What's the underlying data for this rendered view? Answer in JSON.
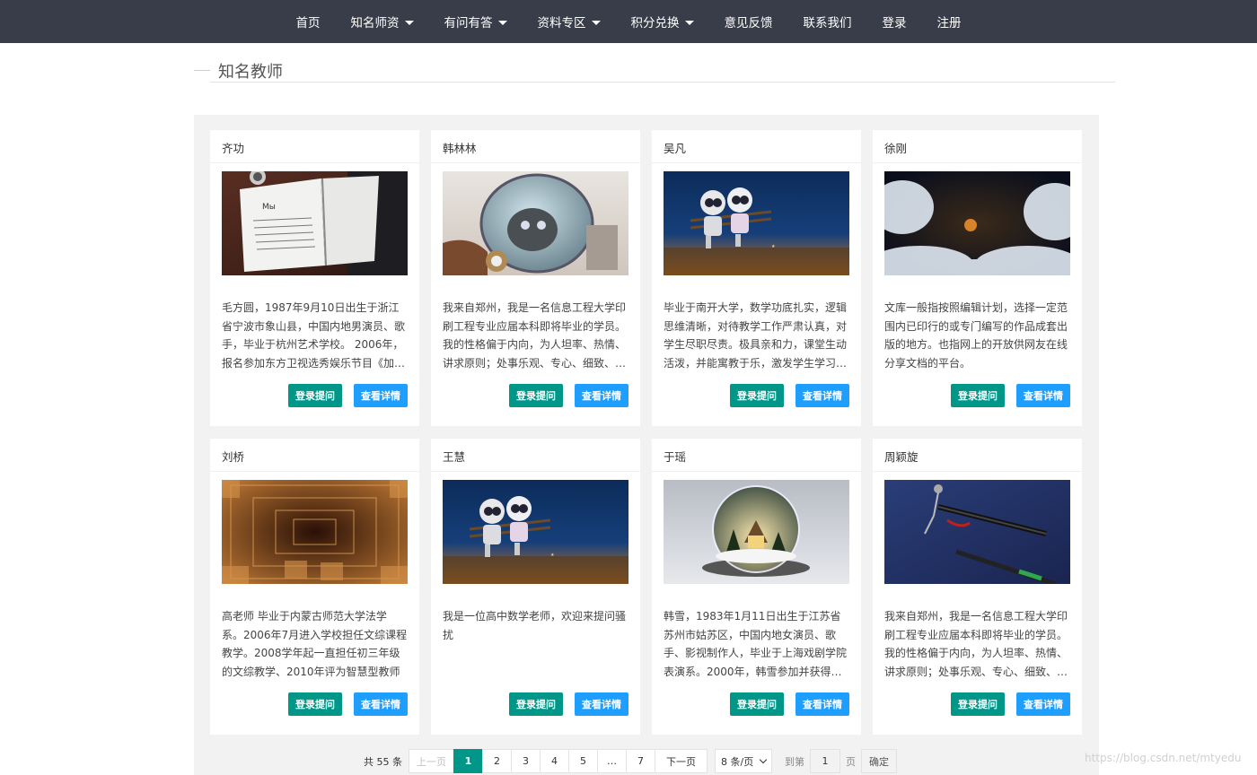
{
  "nav": {
    "items": [
      {
        "label": "首页",
        "dropdown": false
      },
      {
        "label": "知名师资",
        "dropdown": true
      },
      {
        "label": "有问有答",
        "dropdown": true
      },
      {
        "label": "资料专区",
        "dropdown": true
      },
      {
        "label": "积分兑换",
        "dropdown": true
      },
      {
        "label": "意见反馈",
        "dropdown": false
      },
      {
        "label": "联系我们",
        "dropdown": false
      },
      {
        "label": "登录",
        "dropdown": false
      },
      {
        "label": "注册",
        "dropdown": false
      }
    ]
  },
  "section": {
    "title": "知名教师"
  },
  "buttons": {
    "ask": "登录提问",
    "detail": "查看详情"
  },
  "teachers": [
    {
      "name": "齐功",
      "image": "notebook-photo",
      "desc": "毛方圆，1987年9月10日出生于浙江省宁波市象山县，中国内地男演员、歌手，毕业于杭州艺术学校。 2006年，报名参加东方卫视选秀娱乐节目《加油！好男儿》"
    },
    {
      "name": "韩林林",
      "image": "astronaut-photo",
      "desc": "我来自郑州，我是一名信息工程大学印刷工程专业应届本科即将毕业的学员。 我的性格偏于内向，为人坦率、热情、讲求原则；处事乐观、专心、细致、头脑清醒"
    },
    {
      "name": "吴凡",
      "image": "robots-bench-photo",
      "desc": "毕业于南开大学，数学功底扎实，逻辑思维清晰，对待教学工作严肃认真，对学生尽职尽责。极具亲和力，课堂生动活泼，并能寓教于乐，激发学生学习兴趣"
    },
    {
      "name": "徐刚",
      "image": "moon-clouds-photo",
      "desc": "文库一般指按照编辑计划，选择一定范围内已印行的或专门编写的作品成套出版的地方。也指网上的开放供网友在线分享文档的平台。"
    },
    {
      "name": "刘桥",
      "image": "cubes-tunnel-photo",
      "desc": "高老师 毕业于内蒙古师范大学法学系。2006年7月进入学校担任文综课程教学。2008学年起一直担任初三年级的文综教学、2010年评为智慧型教师"
    },
    {
      "name": "王慧",
      "image": "robots-bench-photo",
      "desc": "我是一位高中数学老师，欢迎来提问骚扰"
    },
    {
      "name": "于瑶",
      "image": "snow-globe-photo",
      "desc": "韩雪，1983年1月11日出生于江苏省苏州市姑苏区，中国内地女演员、歌手、影视制作人，毕业于上海戏剧学院表演系。2000年，韩雪参加并获得第一名"
    },
    {
      "name": "周颖旋",
      "image": "pen-figure-photo",
      "desc": "我来自郑州，我是一名信息工程大学印刷工程专业应届本科即将毕业的学员。 我的性格偏于内向，为人坦率、热情、讲求原则；处事乐观、专心、细致、头脑清醒"
    }
  ],
  "pager": {
    "count": "共 55 条",
    "prev": "上一页",
    "pages": [
      "1",
      "2",
      "3",
      "4",
      "5",
      "…",
      "7"
    ],
    "active": "1",
    "next": "下一页",
    "per_page": "8 条/页",
    "goto_label": "到第",
    "goto_value": "1",
    "page_unit": "页",
    "confirm": "确定"
  },
  "watermark": "https://blog.csdn.net/mtyedu"
}
